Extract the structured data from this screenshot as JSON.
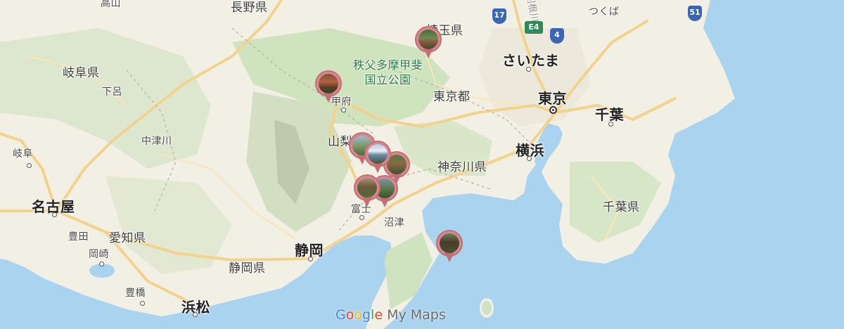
{
  "colors": {
    "sea": "#a9d3ef",
    "land": "#f2efe4",
    "forest": "#c9e0b8",
    "road": "#f3d38c",
    "pin": "#d8888f"
  },
  "labels": {
    "takayama": "高山",
    "nagano_pref": "長野県",
    "gifu_pref": "岐阜県",
    "gero": "下呂",
    "nakatsugawa": "中津川",
    "gifu": "岐阜",
    "nagoya": "名古屋",
    "toyota": "豊田",
    "aichi_pref": "愛知県",
    "okazaki": "岡崎",
    "toyohashi": "豊橋",
    "hamamatsu": "浜松",
    "shizuoka": "静岡",
    "shizuoka_pref": "静岡県",
    "fuji": "富士",
    "numazu": "沼津",
    "kofu": "甲府",
    "yamanashi_pref": "山梨県",
    "park": "秩父多摩甲斐\n国立公園",
    "saitama_pref": "埼玉県",
    "tokyo_to": "東京都",
    "saitama": "さいたま",
    "tokyo": "東京",
    "chiba": "千葉",
    "yokohama": "横浜",
    "kanagawa_pref": "神奈川県",
    "chiba_pref": "千葉県",
    "tsukuba": "つくば",
    "tone": "利根川"
  },
  "road_shields": {
    "r17": "17",
    "e4": "E4",
    "r4": "4",
    "r51": "51"
  },
  "pins": [
    {
      "name": "pin-saitama",
      "icon": "photo-marker"
    },
    {
      "name": "pin-kofu",
      "icon": "photo-marker"
    },
    {
      "name": "pin-yamanashi-1",
      "icon": "photo-marker"
    },
    {
      "name": "pin-fuji-view",
      "icon": "photo-marker"
    },
    {
      "name": "pin-yamanashi-2",
      "icon": "photo-marker"
    },
    {
      "name": "pin-fuji-1",
      "icon": "photo-marker"
    },
    {
      "name": "pin-fuji-2",
      "icon": "photo-marker"
    },
    {
      "name": "pin-izu",
      "icon": "photo-marker"
    }
  ],
  "brand": {
    "google": "Google",
    "product": " My Maps"
  }
}
